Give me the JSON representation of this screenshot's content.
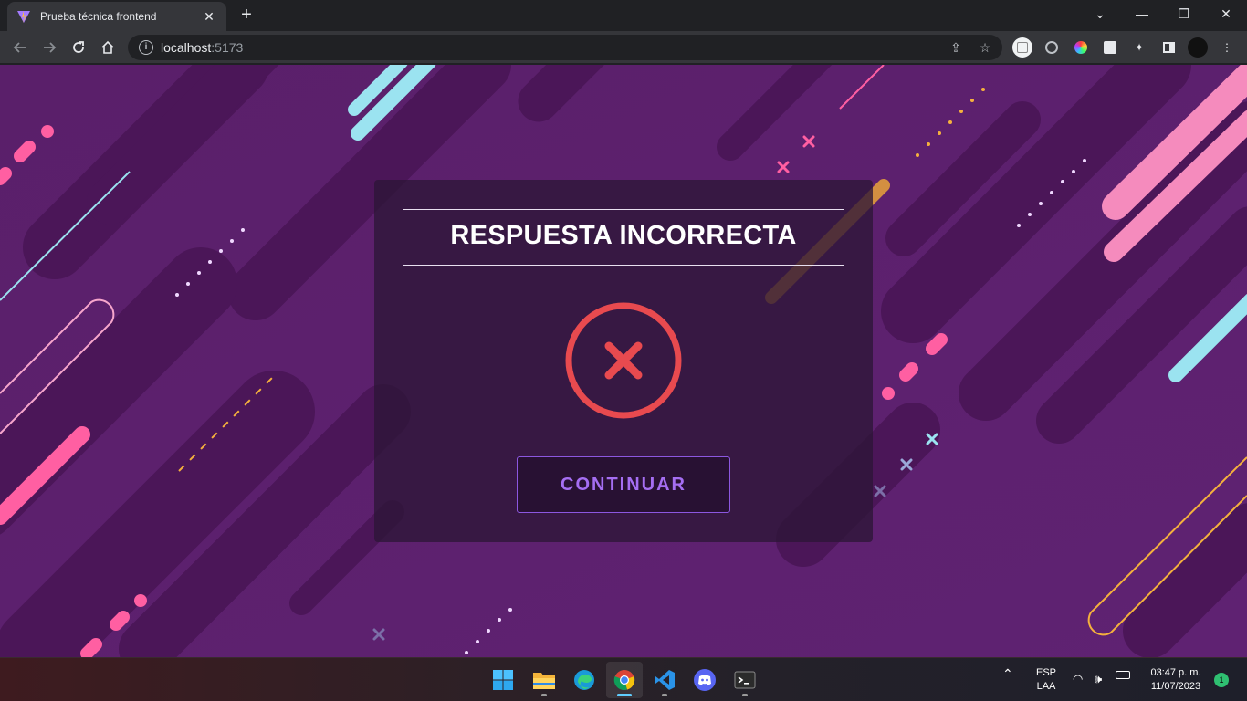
{
  "browser": {
    "tab_title": "Prueba técnica frontend",
    "url_host": "localhost",
    "url_port": ":5173"
  },
  "modal": {
    "title": "RESPUESTA INCORRECTA",
    "continue_label": "CONTINUAR",
    "error_color": "#e84a4f",
    "accent_color": "#a56ef2"
  },
  "taskbar": {
    "apps": [
      "start",
      "file-explorer",
      "edge",
      "chrome",
      "vscode",
      "discord",
      "terminal"
    ],
    "lang_line1": "ESP",
    "lang_line2": "LAA",
    "time": "03:47 p. m.",
    "date": "11/07/2023",
    "notification_count": "1"
  }
}
